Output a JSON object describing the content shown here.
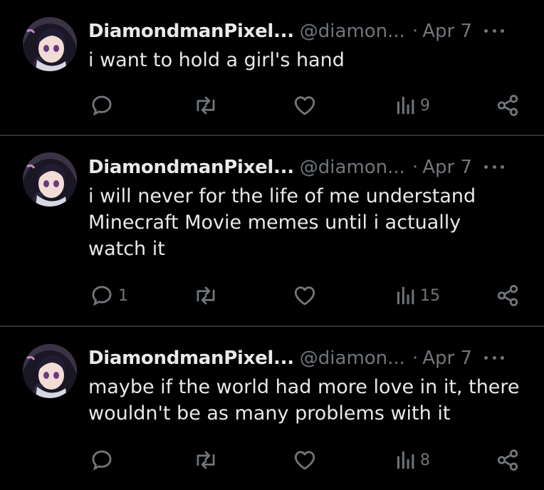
{
  "user": {
    "display_name": "DiamondmanPixel...",
    "handle": "@diamon...",
    "separator": "·"
  },
  "tweets": [
    {
      "date": "Apr 7",
      "text": "i want to hold a girl's hand",
      "replies": "",
      "reposts": "",
      "likes": "",
      "views": "9"
    },
    {
      "date": "Apr 7",
      "text": "i will never for the life of me understand\nMinecraft Movie memes until i actually\nwatch it",
      "replies": "1",
      "reposts": "",
      "likes": "",
      "views": "15"
    },
    {
      "date": "Apr 7",
      "text": "maybe if the world had more love in it, there\nwouldn't be as many problems with it",
      "replies": "",
      "reposts": "",
      "likes": "",
      "views": "8"
    }
  ],
  "icons": {
    "reply": "reply-icon",
    "repost": "repost-icon",
    "like": "like-icon",
    "views": "views-icon",
    "share": "share-icon",
    "more": "more-icon"
  },
  "colors": {
    "background": "#000000",
    "text": "#e7e9ea",
    "muted": "#71767b",
    "divider": "#2f3336"
  }
}
